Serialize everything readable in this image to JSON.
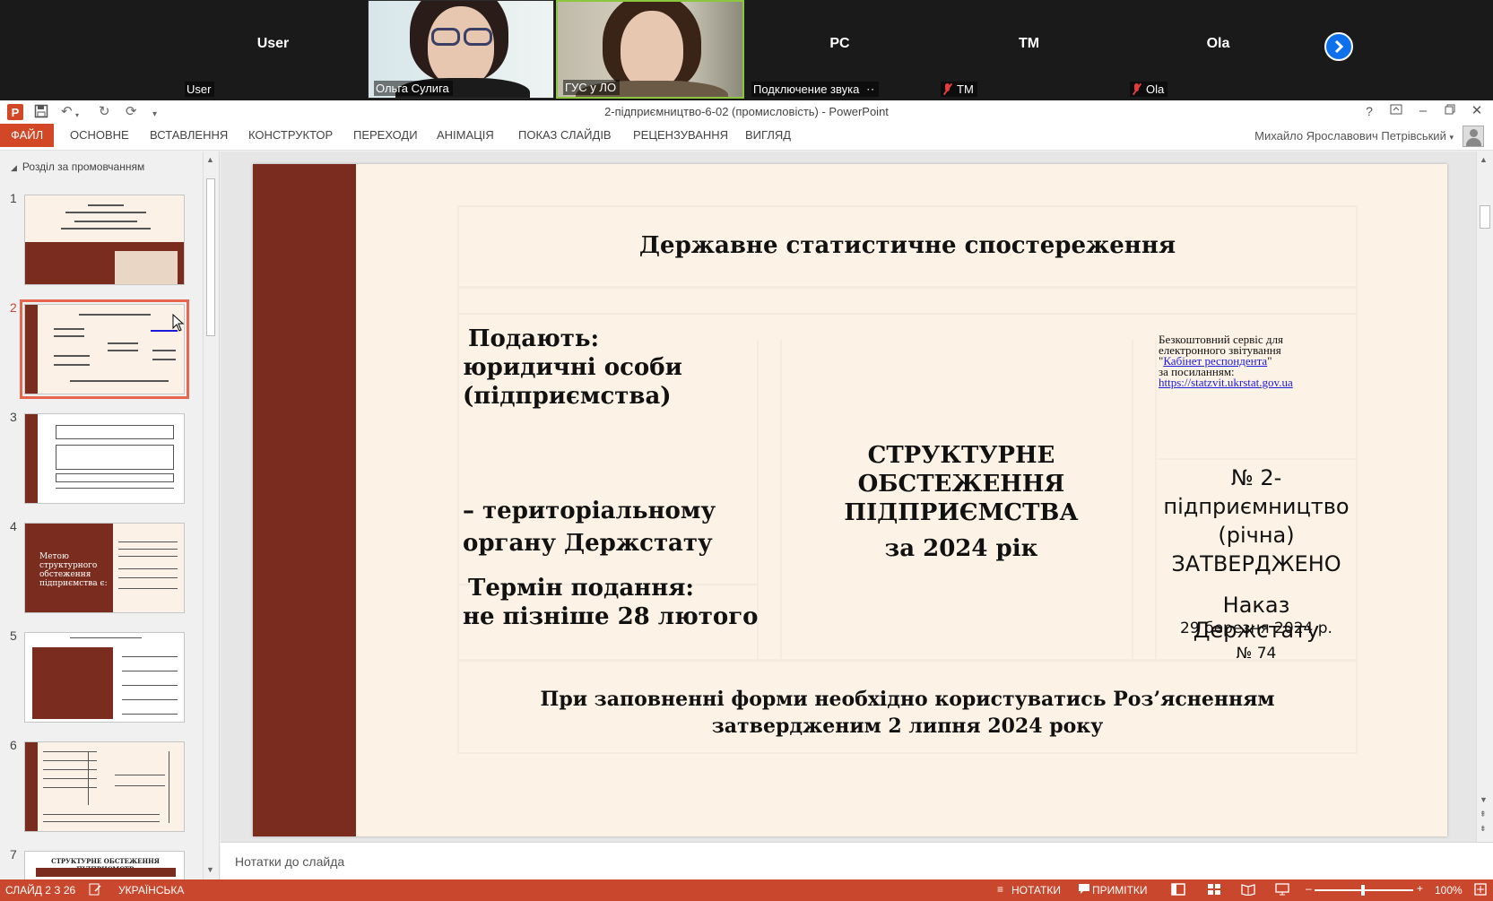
{
  "video_tiles": [
    {
      "center_name": "User",
      "corner_name": "User"
    },
    {
      "corner_name": "Ольга Сулига"
    },
    {
      "corner_name": "ГУС у ЛО"
    },
    {
      "center_name": "PC",
      "corner_name": "Подключение звука"
    },
    {
      "center_name": "TM",
      "corner_name": "TM"
    },
    {
      "center_name": "Ola",
      "corner_name": "Ola"
    }
  ],
  "window": {
    "title": "2-підприємництво-6-02 (промисловість) - PowerPoint",
    "help": "?"
  },
  "ribbon": {
    "tabs": [
      "ФАЙЛ",
      "ОСНОВНЕ",
      "ВСТАВЛЕННЯ",
      "КОНСТРУКТОР",
      "ПЕРЕХОДИ",
      "АНІМАЦІЯ",
      "ПОКАЗ СЛАЙДІВ",
      "РЕЦЕНЗУВАННЯ",
      "ВИГЛЯД"
    ],
    "user_name": "Михайло Ярославович Петрівський"
  },
  "thumbnails": {
    "section": "Розділ за промовчанням",
    "numbers": [
      "1",
      "2",
      "3",
      "4",
      "5",
      "6",
      "7"
    ],
    "selected": "2",
    "slide4_text": "Метою структурного обстеження підприємства є:",
    "slide7_title": "СТРУКТУРНЕ ОБСТЕЖЕННЯ ПІДПРИЄМСТВ"
  },
  "slide": {
    "title": "Державне статистичне спостереження",
    "submit_label": "Подають:",
    "submit_who_1": "юридичні особи",
    "submit_who_2": "(підприємства)",
    "submit_to_1": "– територіальному",
    "submit_to_2": "органу Держстату",
    "deadline_label": "Термін подання:",
    "deadline_value": "не пізніше 28 лютого",
    "center_1": "СТРУКТУРНЕ",
    "center_2": "ОБСТЕЖЕННЯ",
    "center_3": "ПІДПРИЄМСТВА",
    "center_4": "за 2024 рік",
    "service_1": "Безкоштовний сервіс для",
    "service_2": "електронного звітування",
    "service_quote_open": "\"",
    "service_link": "Кабінет респондента",
    "service_quote_close": "\"",
    "service_3": "за посиланням:",
    "service_url": "https://statzvit.ukrstat.gov.ua",
    "form_1": "№ 2-",
    "form_2": "підприємництво",
    "form_3": "(річна)",
    "form_4": "ЗАТВЕРДЖЕНО",
    "order_1": "Наказ Держстату",
    "order_2": "29 березня 2024 р.",
    "order_3": "№ 74",
    "footer_1": "При заповненні форми необхідно користуватись Роз’ясненням",
    "footer_2": "затвердженим  2 липня 2024 року"
  },
  "notes_placeholder": "Нотатки до слайда",
  "status": {
    "slide": "СЛАЙД 2 З 26",
    "language": "УКРАЇНСЬКА",
    "notes": "НОТАТКИ",
    "comments": "ПРИМІТКИ",
    "zoom": "100%"
  },
  "colors": {
    "accent": "#d24726",
    "slide_bar": "#7a2c1e",
    "slide_bg": "#fcf2e6"
  }
}
